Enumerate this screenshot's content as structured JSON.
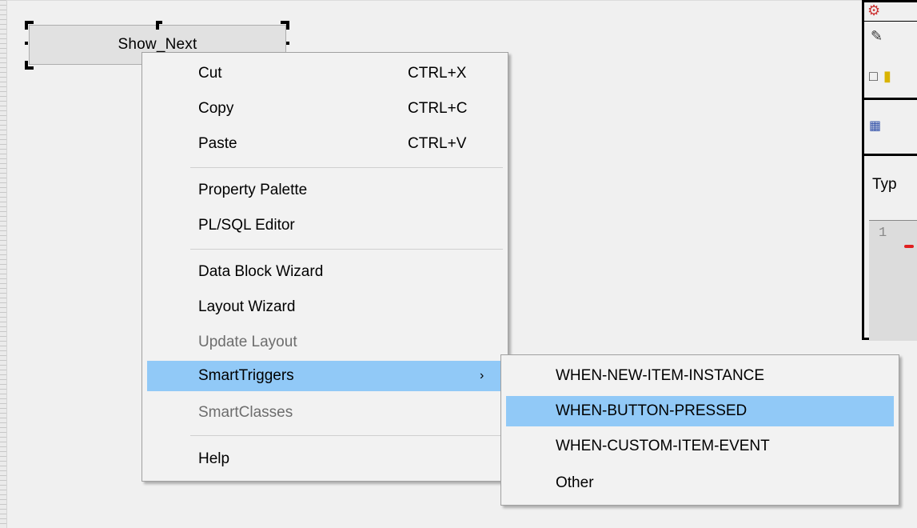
{
  "form": {
    "button_label": "Show_Next"
  },
  "context_menu": {
    "items": [
      {
        "label": "Cut",
        "shortcut": "CTRL+X"
      },
      {
        "label": "Copy",
        "shortcut": "CTRL+C"
      },
      {
        "label": "Paste",
        "shortcut": "CTRL+V"
      },
      {
        "label": "Property Palette"
      },
      {
        "label": "PL/SQL Editor"
      },
      {
        "label": "Data Block Wizard"
      },
      {
        "label": "Layout Wizard"
      },
      {
        "label": "Update Layout",
        "disabled": true
      },
      {
        "label": "SmartTriggers",
        "highlighted": true,
        "has_submenu": true,
        "arrow": "›"
      },
      {
        "label": "SmartClasses",
        "disabled": true
      },
      {
        "label": "Help"
      }
    ]
  },
  "submenu": {
    "items": [
      {
        "label": "WHEN-NEW-ITEM-INSTANCE"
      },
      {
        "label": "WHEN-BUTTON-PRESSED",
        "highlighted": true
      },
      {
        "label": "WHEN-CUSTOM-ITEM-EVENT"
      },
      {
        "label": "Other"
      }
    ]
  },
  "side_panel": {
    "type_label": "Typ",
    "editor_line_number": "1",
    "icons": [
      "compile-icon",
      "edit-icon",
      "new-file-icon",
      "open-folder-icon",
      "binary-data-icon"
    ]
  },
  "colors": {
    "highlight": "#91c9f7",
    "menu_bg": "#f2f2f2",
    "canvas_bg": "#f0f0f0",
    "disabled_text": "#6d6d6d"
  }
}
